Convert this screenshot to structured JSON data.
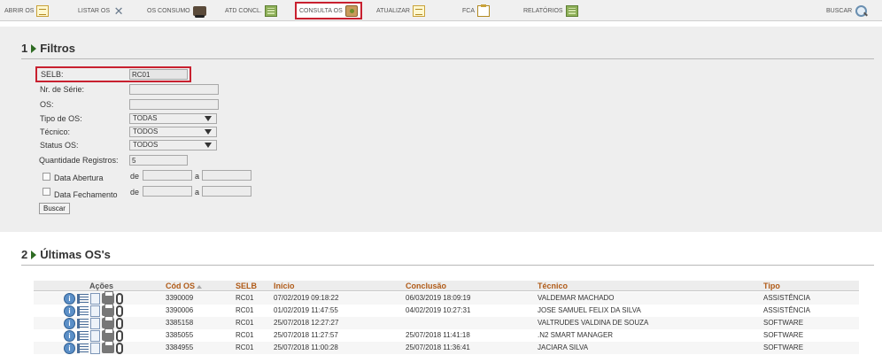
{
  "toolbar": {
    "items": [
      {
        "label": "ABRIR OS",
        "icon": "note-icon"
      },
      {
        "label": "LISTAR OS",
        "icon": "tools-icon"
      },
      {
        "label": "OS CONSUMO",
        "icon": "truck-icon"
      },
      {
        "label": "ATD CONCL.",
        "icon": "grid-icon"
      },
      {
        "label": "CONSULTA OS",
        "icon": "box-icon"
      },
      {
        "label": "ATUALIZAR",
        "icon": "note-icon"
      },
      {
        "label": "FCA",
        "icon": "clipboard-icon"
      },
      {
        "label": "RELATÓRIOS",
        "icon": "grid-icon"
      }
    ],
    "search_label": "BUSCAR",
    "active_item": "CONSULTA OS",
    "highlight_color": "#c8202f"
  },
  "filters": {
    "number": "1",
    "title": "Filtros",
    "selb_label": "SELB:",
    "selb_value": "RC01",
    "serie_label": "Nr. de Série:",
    "serie_value": "",
    "os_label": "OS:",
    "os_value": "",
    "tipo_label": "Tipo de OS:",
    "tipo_value": "TODAS",
    "tecnico_label": "Técnico:",
    "tecnico_value": "TODOS",
    "status_label": "Status OS:",
    "status_value": "TODOS",
    "qtd_label": "Quantidade Registros:",
    "qtd_value": "5",
    "abertura_label": "Data Abertura",
    "fechamento_label": "Data Fechamento",
    "de_label": "de",
    "a_label": "a",
    "buscar_label": "Buscar"
  },
  "results": {
    "number": "2",
    "title": "Últimas OS's",
    "headers": {
      "acoes": "Ações",
      "cod": "Cód OS",
      "selb": "SELB",
      "inicio": "Início",
      "conclusao": "Conclusão",
      "tecnico": "Técnico",
      "tipo": "Tipo"
    },
    "rows": [
      {
        "cod": "3390009",
        "selb": "RC01",
        "inicio": "07/02/2019 09:18:22",
        "conclusao": "06/03/2019 18:09:19",
        "tecnico": "VALDEMAR MACHADO",
        "tipo": "ASSISTÊNCIA"
      },
      {
        "cod": "3390006",
        "selb": "RC01",
        "inicio": "01/02/2019 11:47:55",
        "conclusao": "04/02/2019 10:27:31",
        "tecnico": "JOSE SAMUEL FELIX DA SILVA",
        "tipo": "ASSISTÊNCIA"
      },
      {
        "cod": "3385158",
        "selb": "RC01",
        "inicio": "25/07/2018 12:27:27",
        "conclusao": "",
        "tecnico": "VALTRUDES VALDINA DE SOUZA",
        "tipo": "SOFTWARE"
      },
      {
        "cod": "3385055",
        "selb": "RC01",
        "inicio": "25/07/2018 11:27:57",
        "conclusao": "25/07/2018 11:41:18",
        "tecnico": ".N2 SMART MANAGER",
        "tipo": "SOFTWARE"
      },
      {
        "cod": "3384955",
        "selb": "RC01",
        "inicio": "25/07/2018 11:00:28",
        "conclusao": "25/07/2018 11:36:41",
        "tecnico": "JACIARA SILVA",
        "tipo": "SOFTWARE"
      }
    ]
  }
}
